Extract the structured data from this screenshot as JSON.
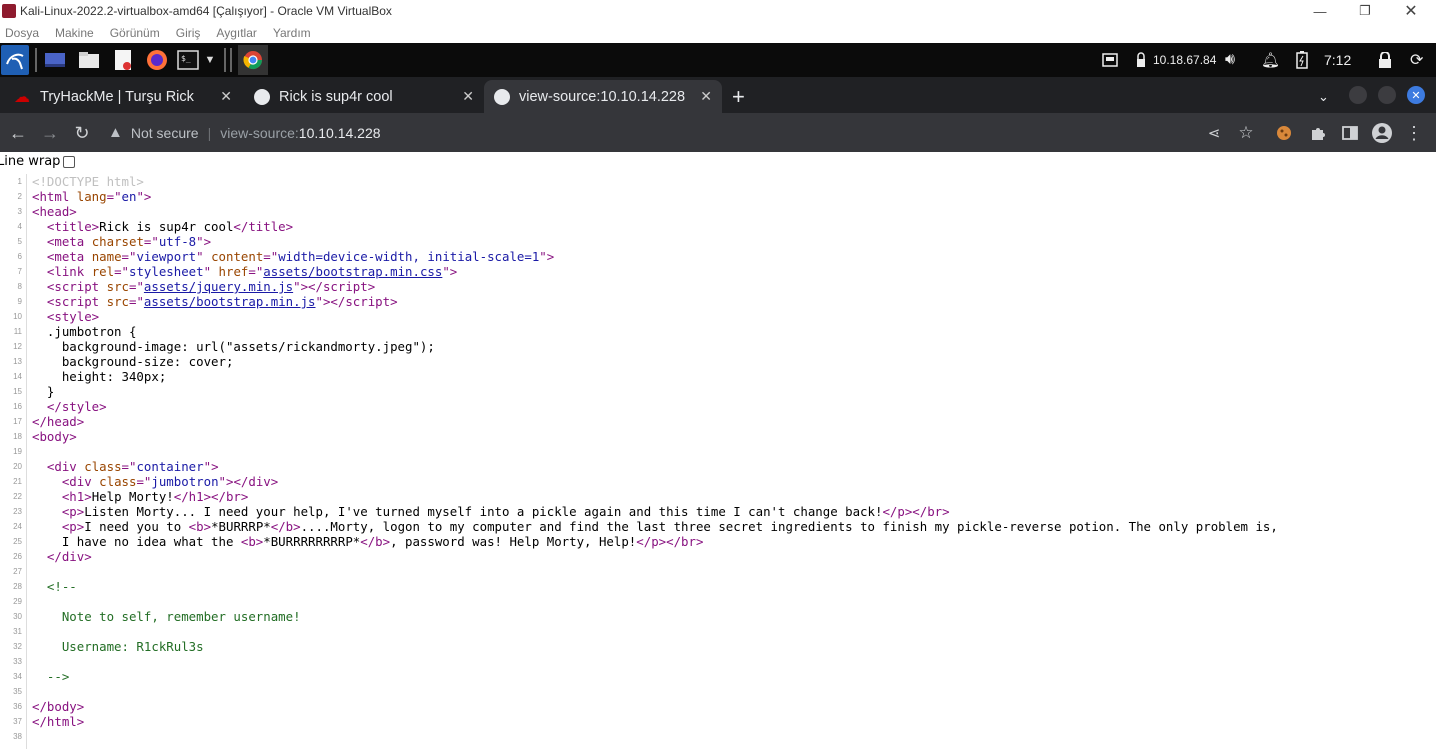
{
  "vbox": {
    "title": "Kali-Linux-2022.2-virtualbox-amd64 [Çalışıyor] - Oracle VM VirtualBox",
    "menu": [
      "Dosya",
      "Makine",
      "Görünüm",
      "Giriş",
      "Aygıtlar",
      "Yardım"
    ]
  },
  "taskbar": {
    "ip": "10.18.67.84",
    "clock": "7:12"
  },
  "tabs": [
    {
      "label": "TryHackMe | Turşu Rick"
    },
    {
      "label": "Rick is sup4r cool"
    },
    {
      "label": "view-source:10.10.14.228"
    }
  ],
  "toolbar": {
    "security": "Not secure",
    "url_prefix": "view-source:",
    "url_host": "10.10.14.228"
  },
  "page": {
    "line_wrap_label": "Line wrap",
    "lines": [
      "1",
      "2",
      "3",
      "4",
      "5",
      "6",
      "7",
      "8",
      "9",
      "10",
      "11",
      "12",
      "13",
      "14",
      "15",
      "16",
      "17",
      "18",
      "19",
      "20",
      "21",
      "22",
      "23",
      "24",
      "25",
      "26",
      "27",
      "28",
      "29",
      "30",
      "31",
      "32",
      "33",
      "34",
      "35",
      "36",
      "37",
      "38"
    ]
  }
}
